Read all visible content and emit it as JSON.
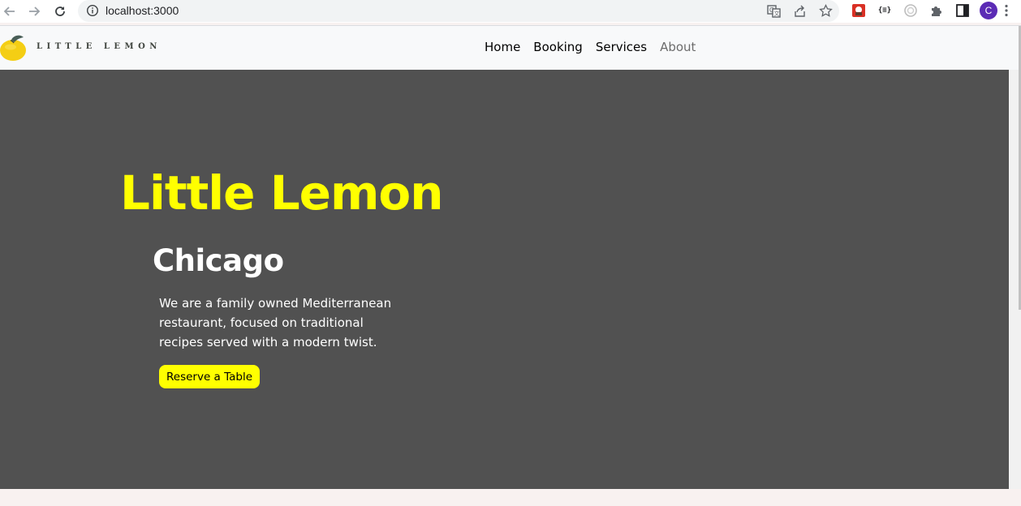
{
  "browser": {
    "url": "localhost:3000",
    "profile_initial": "C",
    "icons": [
      "back-icon",
      "forward-icon",
      "reload-icon",
      "site-info-icon",
      "translate-icon",
      "share-icon",
      "bookmark-star-icon",
      "extension-icon",
      "json-extension-icon",
      "extension-circle-icon",
      "puzzle-icon",
      "side-panel-icon",
      "menu-kebab-icon"
    ],
    "json_ext_label": "{≡}"
  },
  "site": {
    "logo_text": "LITTLE LEMON",
    "nav": [
      {
        "label": "Home"
      },
      {
        "label": "Booking"
      },
      {
        "label": "Services"
      },
      {
        "label": "About"
      }
    ]
  },
  "hero": {
    "title": "Little Lemon",
    "subtitle": "Chicago",
    "description": "We are a family owned Mediterranean restaurant, focused on traditional recipes served with a modern twist.",
    "cta_label": "Reserve a Table"
  },
  "colors": {
    "hero_bg": "#515151",
    "accent_yellow": "#ffff00",
    "header_bg": "#f8f9fa",
    "page_bg": "#f8f1f0"
  }
}
